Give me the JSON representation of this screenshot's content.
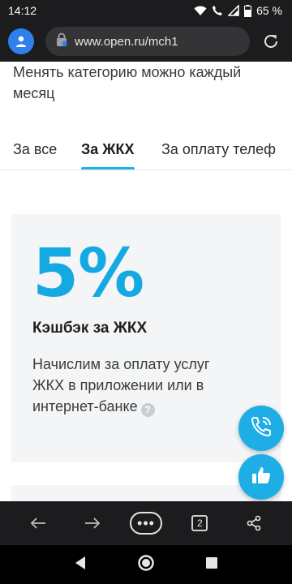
{
  "status_bar": {
    "time": "14:12",
    "battery": "65 %"
  },
  "browser": {
    "url": "www.open.ru/mch1",
    "tab_count": "2",
    "menu_label": "•••"
  },
  "page": {
    "intro_text": "Менять категорию можно каждый месяц",
    "tabs": [
      {
        "label": "За все",
        "active": false
      },
      {
        "label": "За ЖКХ",
        "active": true
      },
      {
        "label": "За оплату телеф",
        "active": false
      }
    ],
    "card": {
      "percent": "5%",
      "title": "Кэшбэк за ЖКХ",
      "description": "Начислим за оплату услуг ЖКХ в приложении или в интернет-банке",
      "help_mark": "?"
    }
  },
  "colors": {
    "accent": "#1eaee5",
    "browser_bar": "#1c1c1e",
    "card_bg": "#f3f5f7"
  },
  "icons": {
    "status": [
      "wifi-icon",
      "phone-call-icon",
      "signal-icon",
      "battery-icon"
    ],
    "browser": [
      "profile-icon",
      "lock-icon",
      "reload-icon"
    ],
    "toolbar": [
      "arrow-back-icon",
      "arrow-forward-icon",
      "menu-dots-icon",
      "tabs-icon",
      "share-icon"
    ],
    "fabs": [
      "phone-icon",
      "thumbs-up-icon"
    ],
    "android_nav": [
      "nav-back-icon",
      "nav-home-icon",
      "nav-recents-icon"
    ]
  }
}
